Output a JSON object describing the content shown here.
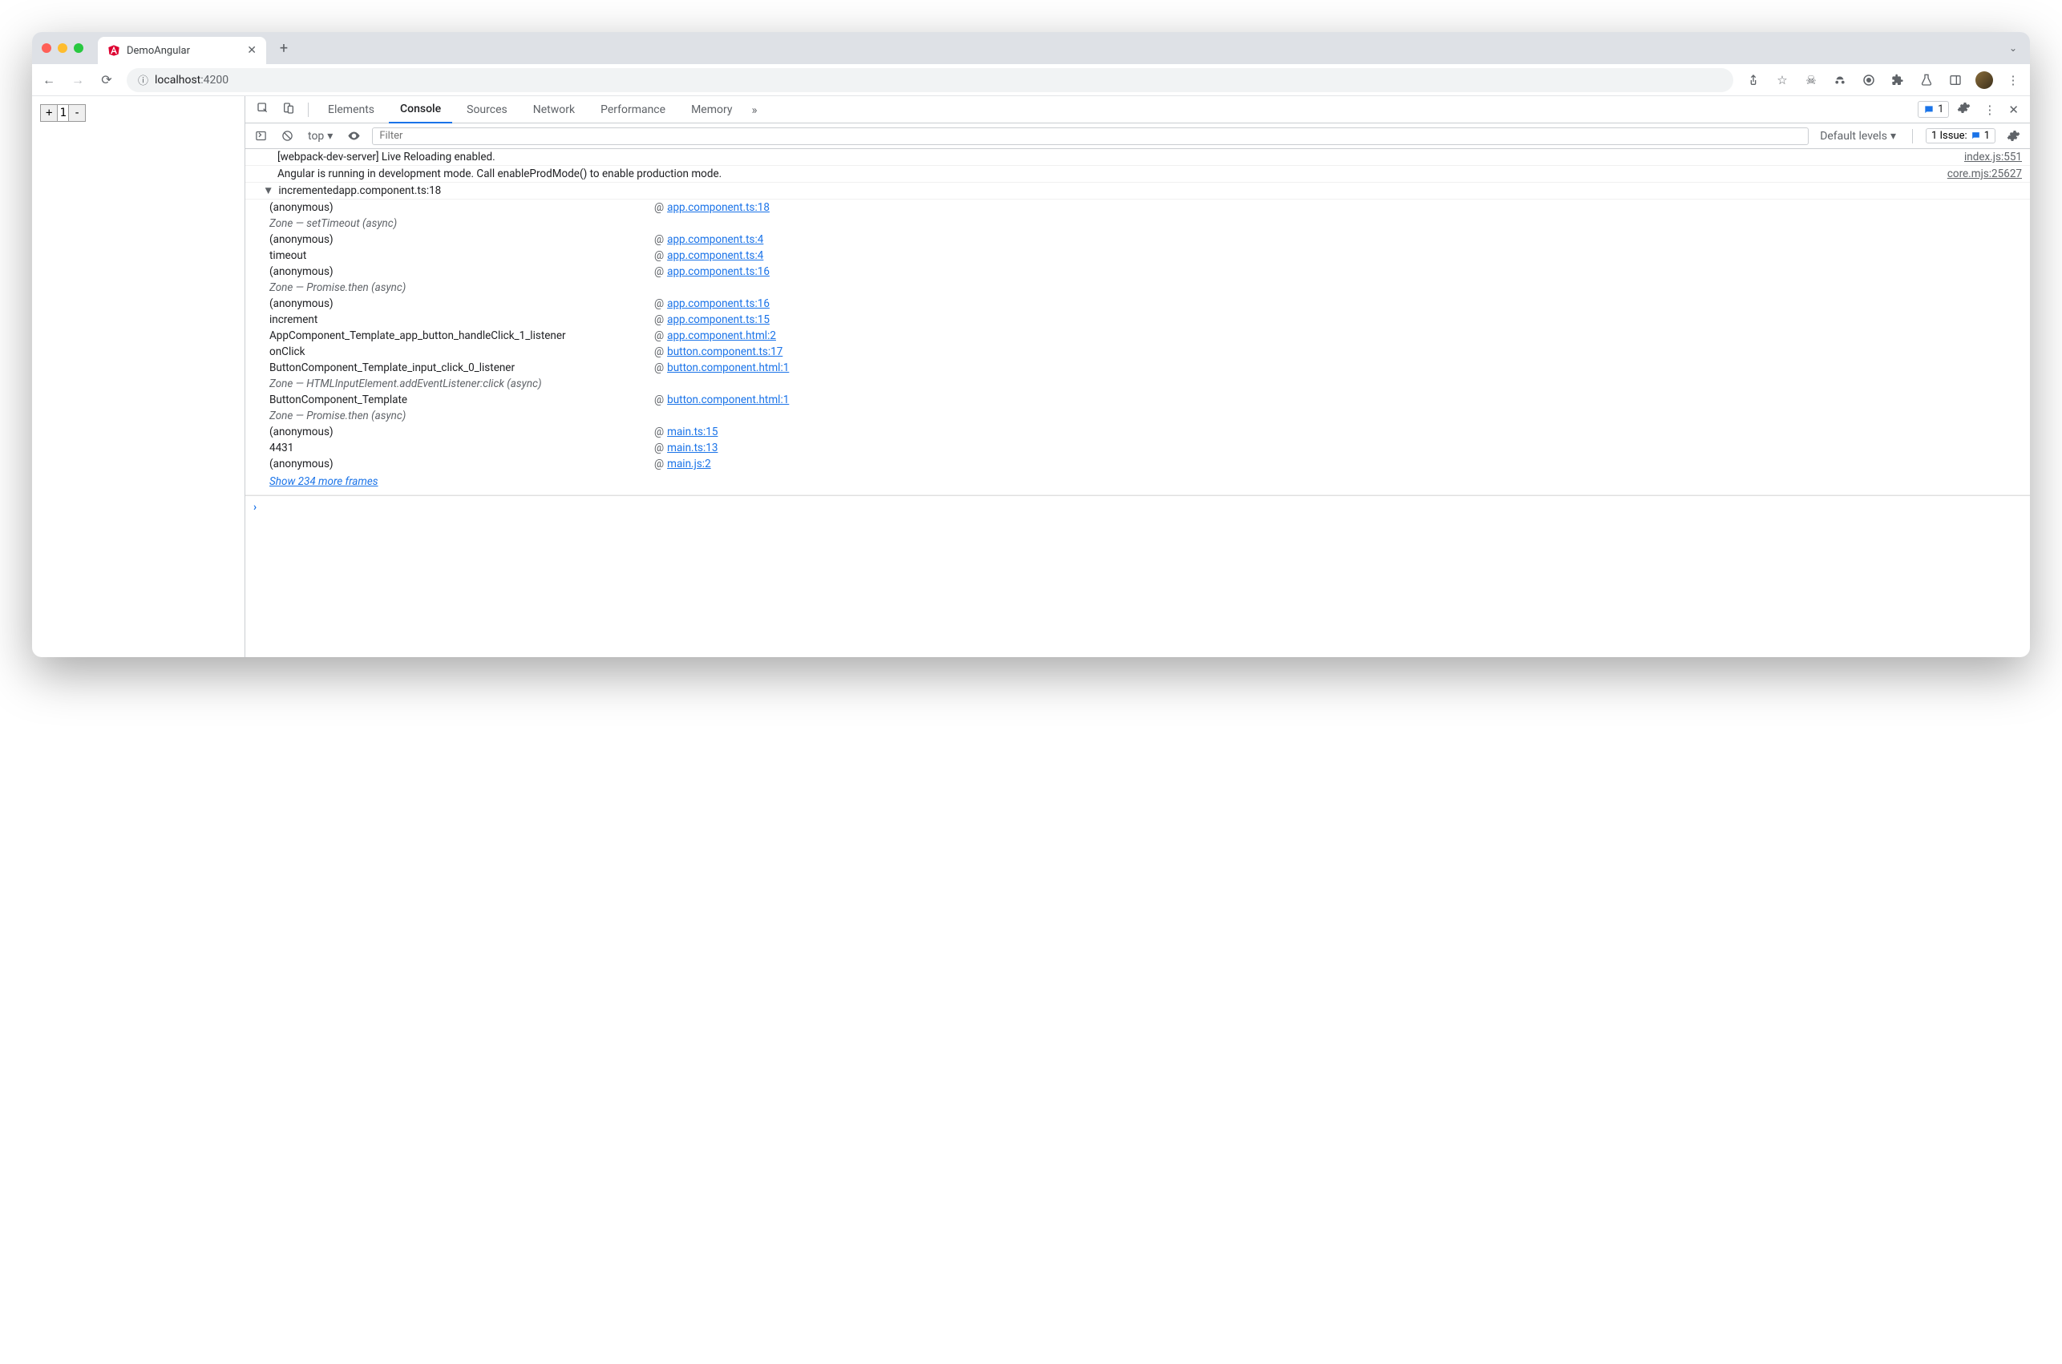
{
  "tab": {
    "title": "DemoAngular"
  },
  "address": {
    "host": "localhost",
    "port": ":4200"
  },
  "page": {
    "counter": "1"
  },
  "devtools": {
    "tabs": [
      "Elements",
      "Console",
      "Sources",
      "Network",
      "Performance",
      "Memory"
    ],
    "active_tab": "Console",
    "issue_chip_count": "1",
    "context": "top",
    "filter_placeholder": "Filter",
    "levels": "Default levels",
    "issues_label": "1 Issue:",
    "issues_count": "1"
  },
  "console": {
    "logs": [
      {
        "msg": "[webpack-dev-server] Live Reloading enabled.",
        "src": "index.js:551"
      },
      {
        "msg": "Angular is running in development mode. Call enableProdMode() to enable production mode.",
        "src": "core.mjs:25627"
      }
    ],
    "trace": {
      "label": "incremented",
      "src": "app.component.ts:18",
      "rows": [
        {
          "fn": "(anonymous)",
          "link": "app.component.ts:18"
        },
        {
          "zone": "Zone — setTimeout (async)"
        },
        {
          "fn": "(anonymous)",
          "link": "app.component.ts:4"
        },
        {
          "fn": "timeout",
          "link": "app.component.ts:4"
        },
        {
          "fn": "(anonymous)",
          "link": "app.component.ts:16"
        },
        {
          "zone": "Zone — Promise.then (async)"
        },
        {
          "fn": "(anonymous)",
          "link": "app.component.ts:16"
        },
        {
          "fn": "increment",
          "link": "app.component.ts:15"
        },
        {
          "fn": "AppComponent_Template_app_button_handleClick_1_listener",
          "link": "app.component.html:2"
        },
        {
          "fn": "onClick",
          "link": "button.component.ts:17"
        },
        {
          "fn": "ButtonComponent_Template_input_click_0_listener",
          "link": "button.component.html:1"
        },
        {
          "zone": "Zone — HTMLInputElement.addEventListener:click (async)"
        },
        {
          "fn": "ButtonComponent_Template",
          "link": "button.component.html:1"
        },
        {
          "zone": "Zone — Promise.then (async)"
        },
        {
          "fn": "(anonymous)",
          "link": "main.ts:15"
        },
        {
          "fn": "4431",
          "link": "main.ts:13"
        },
        {
          "fn": "(anonymous)",
          "link": "main.js:2"
        }
      ],
      "more": "Show 234 more frames"
    }
  }
}
